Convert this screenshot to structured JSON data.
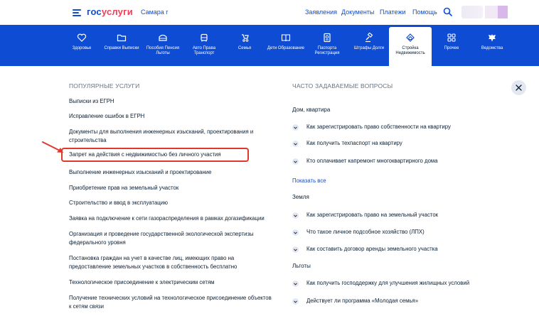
{
  "header": {
    "logo_part1": "гос",
    "logo_part2": "услуги",
    "city": "Самара г",
    "nav": [
      "Заявления",
      "Документы",
      "Платежи",
      "Помощь"
    ]
  },
  "categories": [
    {
      "label": "Здоровье",
      "icon": "health-icon"
    },
    {
      "label": "Справки Выписки",
      "icon": "folder-icon"
    },
    {
      "label": "Пособия Пенсия Льготы",
      "icon": "wallet-icon"
    },
    {
      "label": "Авто Права Транспорт",
      "icon": "car-icon"
    },
    {
      "label": "Семья",
      "icon": "stroller-icon"
    },
    {
      "label": "Дети Образование",
      "icon": "book-icon"
    },
    {
      "label": "Паспорта Регистрация",
      "icon": "passport-icon"
    },
    {
      "label": "Штрафы Долги",
      "icon": "gavel-icon"
    },
    {
      "label": "Стройка Недвижимость",
      "icon": "house-icon"
    },
    {
      "label": "Прочее",
      "icon": "grid-icon"
    },
    {
      "label": "Ведомства",
      "icon": "eagle-icon"
    }
  ],
  "popular": {
    "title": "ПОПУЛЯРНЫЕ УСЛУГИ",
    "items": [
      "Выписки из ЕГРН",
      "Исправление ошибок в ЕГРН",
      "Документы для выполнения инженерных изысканий, проектирования и строительства",
      "Запрет на действия с недвижимостью без личного участия",
      "Выполнение инженерных изысканий и проектирование",
      "Приобретение прав на земельный участок",
      "Строительство и ввод в эксплуатацию",
      "Заявка на подключение к сети газораспределения в рамках догазификации",
      "Организация и проведение государственной экологической экспертизы федерального уровня",
      "Постановка граждан на учет в качестве лиц, имеющих право на предоставление земельных участков в собственность бесплатно",
      "Технологическое присоединение к электрическим сетям",
      "Получение технических условий на технологическое присоединение объектов к сетям связи"
    ]
  },
  "faq": {
    "title": "ЧАСТО ЗАДАВАЕМЫЕ ВОПРОСЫ",
    "groups": [
      {
        "title": "Дом, квартира",
        "questions": [
          "Как зарегистрировать право собственности на квартиру",
          "Как получить техпаспорт на квартиру",
          "Кто оплачивает капремонт многоквартирного дома"
        ]
      },
      {
        "title": "Земля",
        "questions": [
          "Как зарегистрировать право на земельный участок",
          "Что такое личное подсобное хозяйство (ЛПХ)",
          "Как составить договор аренды земельного участка"
        ]
      },
      {
        "title": "Льготы",
        "questions": [
          "Как получить господдержку для улучшения жилищных условий",
          "Действует ли программа «Молодая семья»"
        ]
      }
    ],
    "show_all": "Показать все"
  },
  "colors": {
    "brand_blue": "#0d4cd3",
    "brand_red": "#ee3f58",
    "highlight": "#e0382c"
  }
}
